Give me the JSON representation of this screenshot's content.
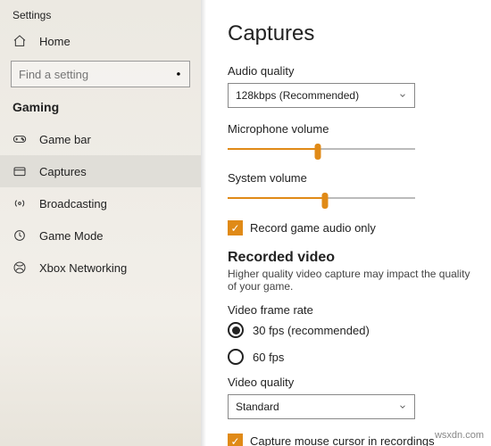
{
  "window": {
    "title": "Settings"
  },
  "sidebar": {
    "home": "Home",
    "search_placeholder": "Find a setting",
    "section": "Gaming",
    "items": [
      {
        "label": "Game bar"
      },
      {
        "label": "Captures"
      },
      {
        "label": "Broadcasting"
      },
      {
        "label": "Game Mode"
      },
      {
        "label": "Xbox Networking"
      }
    ]
  },
  "main": {
    "heading": "Captures",
    "audio_quality": {
      "label": "Audio quality",
      "value": "128kbps (Recommended)"
    },
    "mic_volume": {
      "label": "Microphone volume",
      "percent": 48
    },
    "sys_volume": {
      "label": "System volume",
      "percent": 52
    },
    "record_audio_only": {
      "label": "Record game audio only",
      "checked": true
    },
    "recorded_video": {
      "heading": "Recorded video",
      "help": "Higher quality video capture may impact the quality of your game."
    },
    "frame_rate": {
      "label": "Video frame rate",
      "options": [
        "30 fps (recommended)",
        "60 fps"
      ],
      "selected": 0
    },
    "video_quality": {
      "label": "Video quality",
      "value": "Standard"
    },
    "capture_cursor": {
      "label": "Capture mouse cursor in recordings",
      "checked": true
    }
  },
  "watermark": "wsxdn.com"
}
